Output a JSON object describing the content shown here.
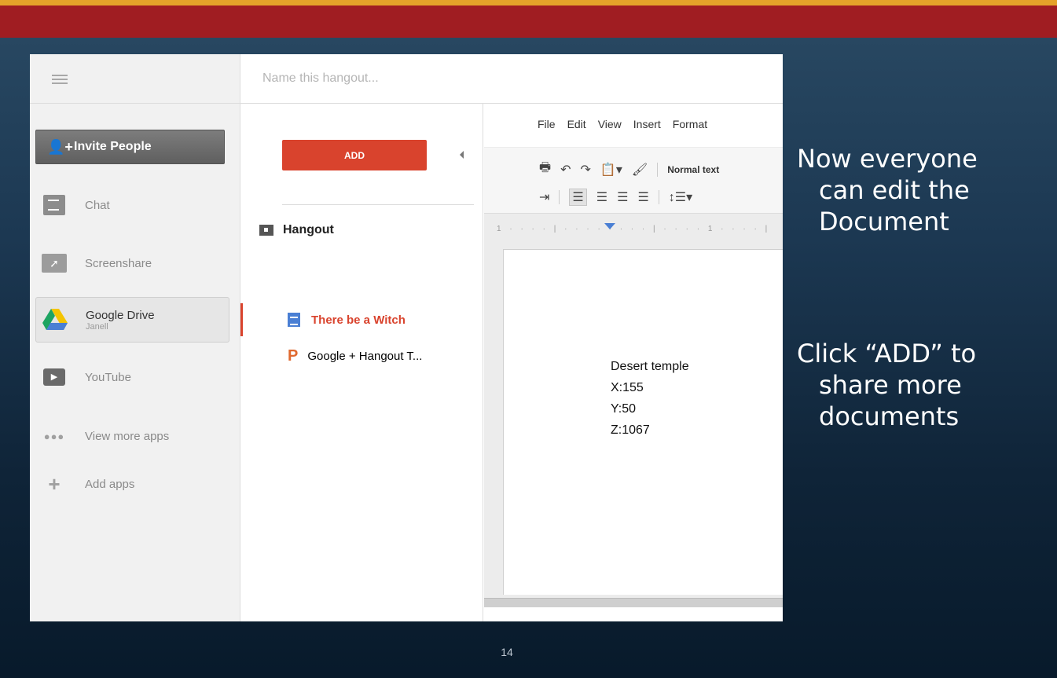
{
  "hangout": {
    "name_placeholder": "Name this hangout...",
    "sidebar": {
      "invite_label": "Invite People",
      "apps": [
        {
          "label": "Chat",
          "icon": "chat-icon"
        },
        {
          "label": "Screenshare",
          "icon": "screenshare-icon"
        },
        {
          "label": "Google Drive",
          "sublabel": "Janell",
          "icon": "google-drive-icon"
        },
        {
          "label": "YouTube",
          "icon": "youtube-icon"
        },
        {
          "label": "View more apps",
          "icon": "more-dots-icon"
        },
        {
          "label": "Add apps",
          "icon": "plus-icon"
        }
      ]
    },
    "drive_panel": {
      "add_label": "ADD",
      "folder_label": "Hangout",
      "files": [
        {
          "label": "There be a Witch",
          "type": "document",
          "selected": true
        },
        {
          "label": "Google + Hangout T...",
          "type": "presentation",
          "selected": false
        }
      ]
    },
    "editor": {
      "menu": [
        "File",
        "Edit",
        "View",
        "Insert",
        "Format"
      ],
      "style_label": "Normal text",
      "ruler_label": "1 · · · · | · · · · · · · · | · · · · 1 · · · · |",
      "doc_lines": [
        "Desert temple",
        "X:155",
        "Y:50",
        "Z:1067"
      ]
    }
  },
  "slide": {
    "callout_1": [
      "Now everyone",
      "can edit the",
      "Document"
    ],
    "callout_2": [
      "Click “ADD” to",
      "share more",
      "documents"
    ],
    "page_number": "14",
    "colors": {
      "top_band": "#a01d22",
      "accent_stripe": "#e5a22a",
      "add_button": "#d9432d"
    }
  }
}
